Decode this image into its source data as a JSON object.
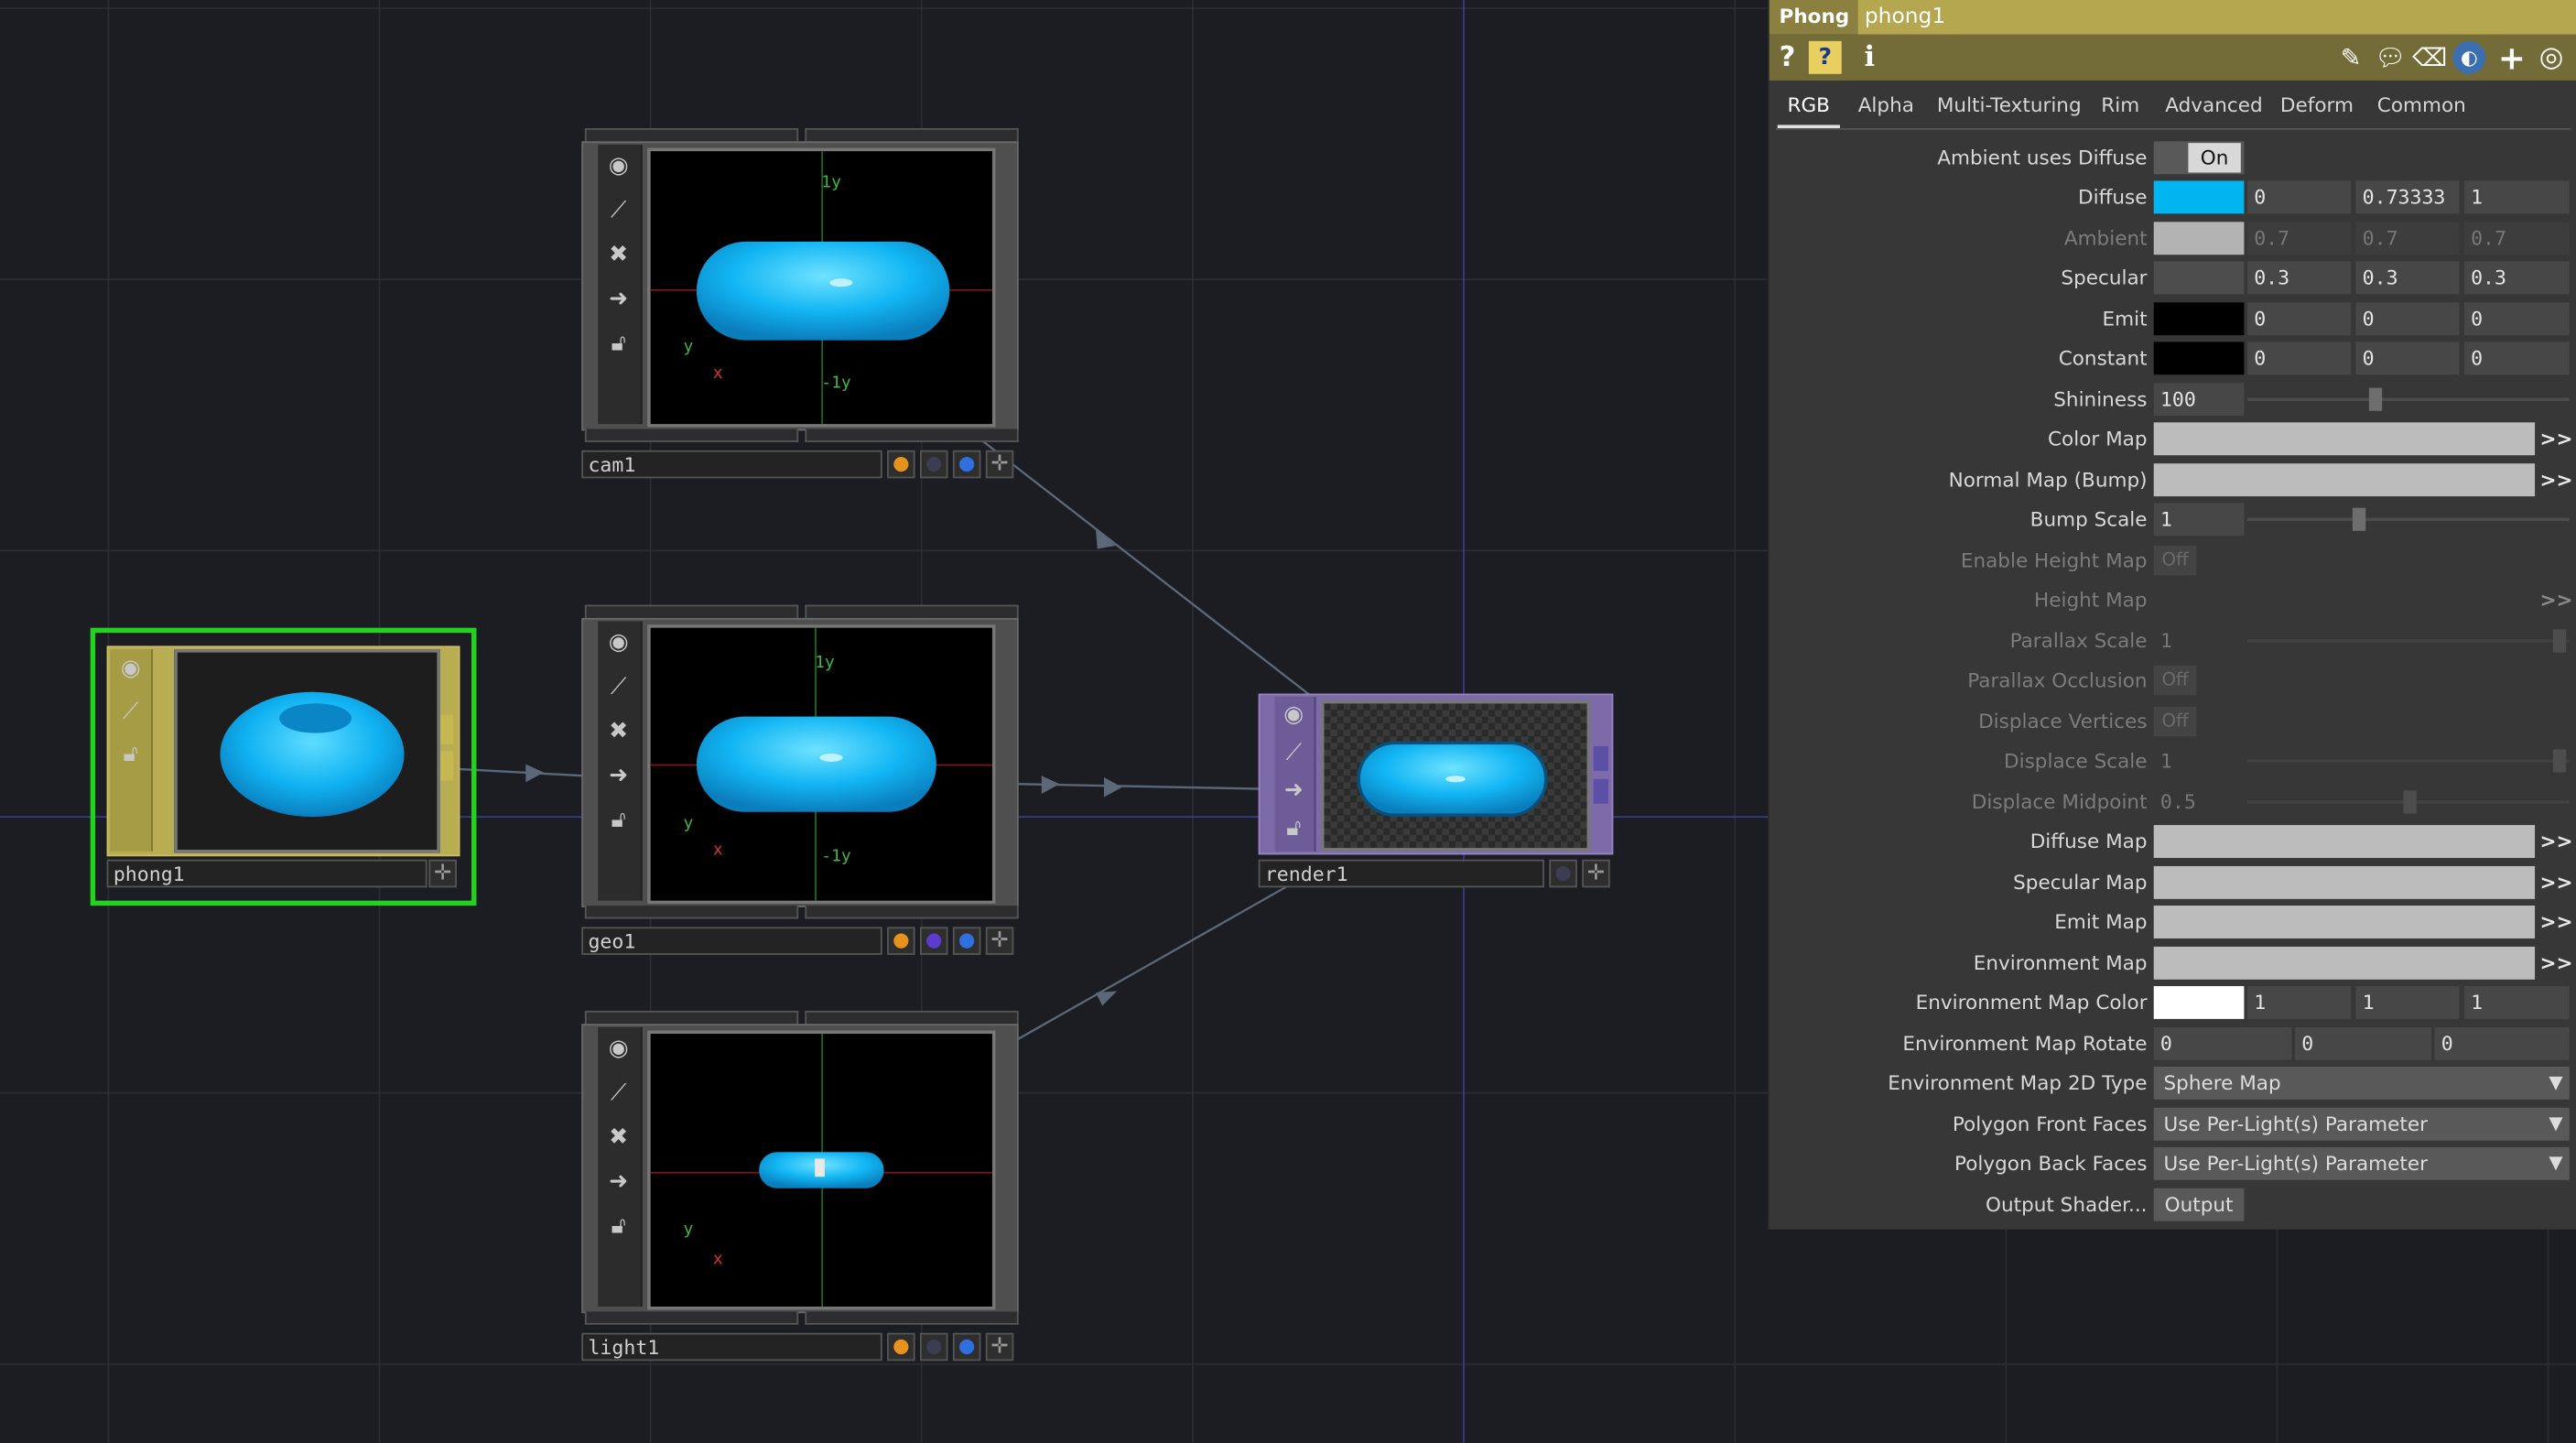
{
  "network": {
    "nodes": {
      "phong1": {
        "label": "phong1"
      },
      "cam1": {
        "label": "cam1",
        "axis_top": "1y",
        "axis_bottom": "-1y",
        "gizmo_y": "y",
        "gizmo_x": "x"
      },
      "geo1": {
        "label": "geo1",
        "axis_top": "1y",
        "axis_bottom": "-1y",
        "gizmo_y": "y",
        "gizmo_x": "x"
      },
      "light1": {
        "label": "light1",
        "gizmo_y": "y",
        "gizmo_x": "x"
      },
      "render1": {
        "label": "render1"
      }
    },
    "node_tools": [
      "viewer-icon",
      "cook-icon",
      "bypass-icon",
      "export-icon",
      "lock-icon"
    ],
    "flag_colors": {
      "orange": "#e8921e",
      "purple": "#5b3ccc",
      "blue": "#2f6fe0",
      "off": "#3c3c52"
    }
  },
  "panel": {
    "op_type": "Phong",
    "op_name": "phong1",
    "tools_left": [
      "help-icon",
      "python-help-icon",
      "info-icon"
    ],
    "tools_right": [
      "edit-icon",
      "comment-icon",
      "eraser-icon",
      "python-icon",
      "add-icon",
      "target-icon"
    ],
    "tabs": [
      "RGB",
      "Alpha",
      "Multi-Texturing",
      "Rim",
      "Advanced",
      "Deform",
      "Common"
    ],
    "active_tab": "RGB",
    "params": {
      "ambient_uses_diffuse": {
        "label": "Ambient uses Diffuse",
        "value": "On"
      },
      "diffuse": {
        "label": "Diffuse",
        "color": "#00b5f0",
        "values": [
          "0",
          "0.73333",
          "1"
        ]
      },
      "ambient": {
        "label": "Ambient",
        "color": "#b3b3b3",
        "values": [
          "0.7",
          "0.7",
          "0.7"
        ]
      },
      "specular": {
        "label": "Specular",
        "color": "#4d4d4d",
        "values": [
          "0.3",
          "0.3",
          "0.3"
        ]
      },
      "emit": {
        "label": "Emit",
        "color": "#000000",
        "values": [
          "0",
          "0",
          "0"
        ]
      },
      "constant": {
        "label": "Constant",
        "color": "#000000",
        "values": [
          "0",
          "0",
          "0"
        ]
      },
      "shininess": {
        "label": "Shininess",
        "value": "100"
      },
      "color_map": {
        "label": "Color Map"
      },
      "normal_map": {
        "label": "Normal Map (Bump)"
      },
      "bump_scale": {
        "label": "Bump Scale",
        "value": "1"
      },
      "enable_height_map": {
        "label": "Enable Height Map",
        "value": "Off"
      },
      "height_map": {
        "label": "Height Map"
      },
      "parallax_scale": {
        "label": "Parallax Scale",
        "value": "1"
      },
      "parallax_occlusion": {
        "label": "Parallax Occlusion",
        "value": "Off"
      },
      "displace_vertices": {
        "label": "Displace Vertices",
        "value": "Off"
      },
      "displace_scale": {
        "label": "Displace Scale",
        "value": "1"
      },
      "displace_midpoint": {
        "label": "Displace Midpoint",
        "value": "0.5"
      },
      "diffuse_map": {
        "label": "Diffuse Map"
      },
      "specular_map": {
        "label": "Specular Map"
      },
      "emit_map": {
        "label": "Emit Map"
      },
      "environment_map": {
        "label": "Environment Map"
      },
      "environment_map_color": {
        "label": "Environment Map Color",
        "color": "#ffffff",
        "values": [
          "1",
          "1",
          "1"
        ]
      },
      "environment_map_rotate": {
        "label": "Environment Map Rotate",
        "values": [
          "0",
          "0",
          "0"
        ]
      },
      "environment_map_2d_type": {
        "label": "Environment Map 2D Type",
        "value": "Sphere Map"
      },
      "polygon_front_faces": {
        "label": "Polygon Front Faces",
        "value": "Use Per-Light(s) Parameter"
      },
      "polygon_back_faces": {
        "label": "Polygon Back Faces",
        "value": "Use Per-Light(s) Parameter"
      },
      "output_shader": {
        "label": "Output Shader...",
        "value": "Output"
      }
    },
    "more_label": ">>"
  }
}
